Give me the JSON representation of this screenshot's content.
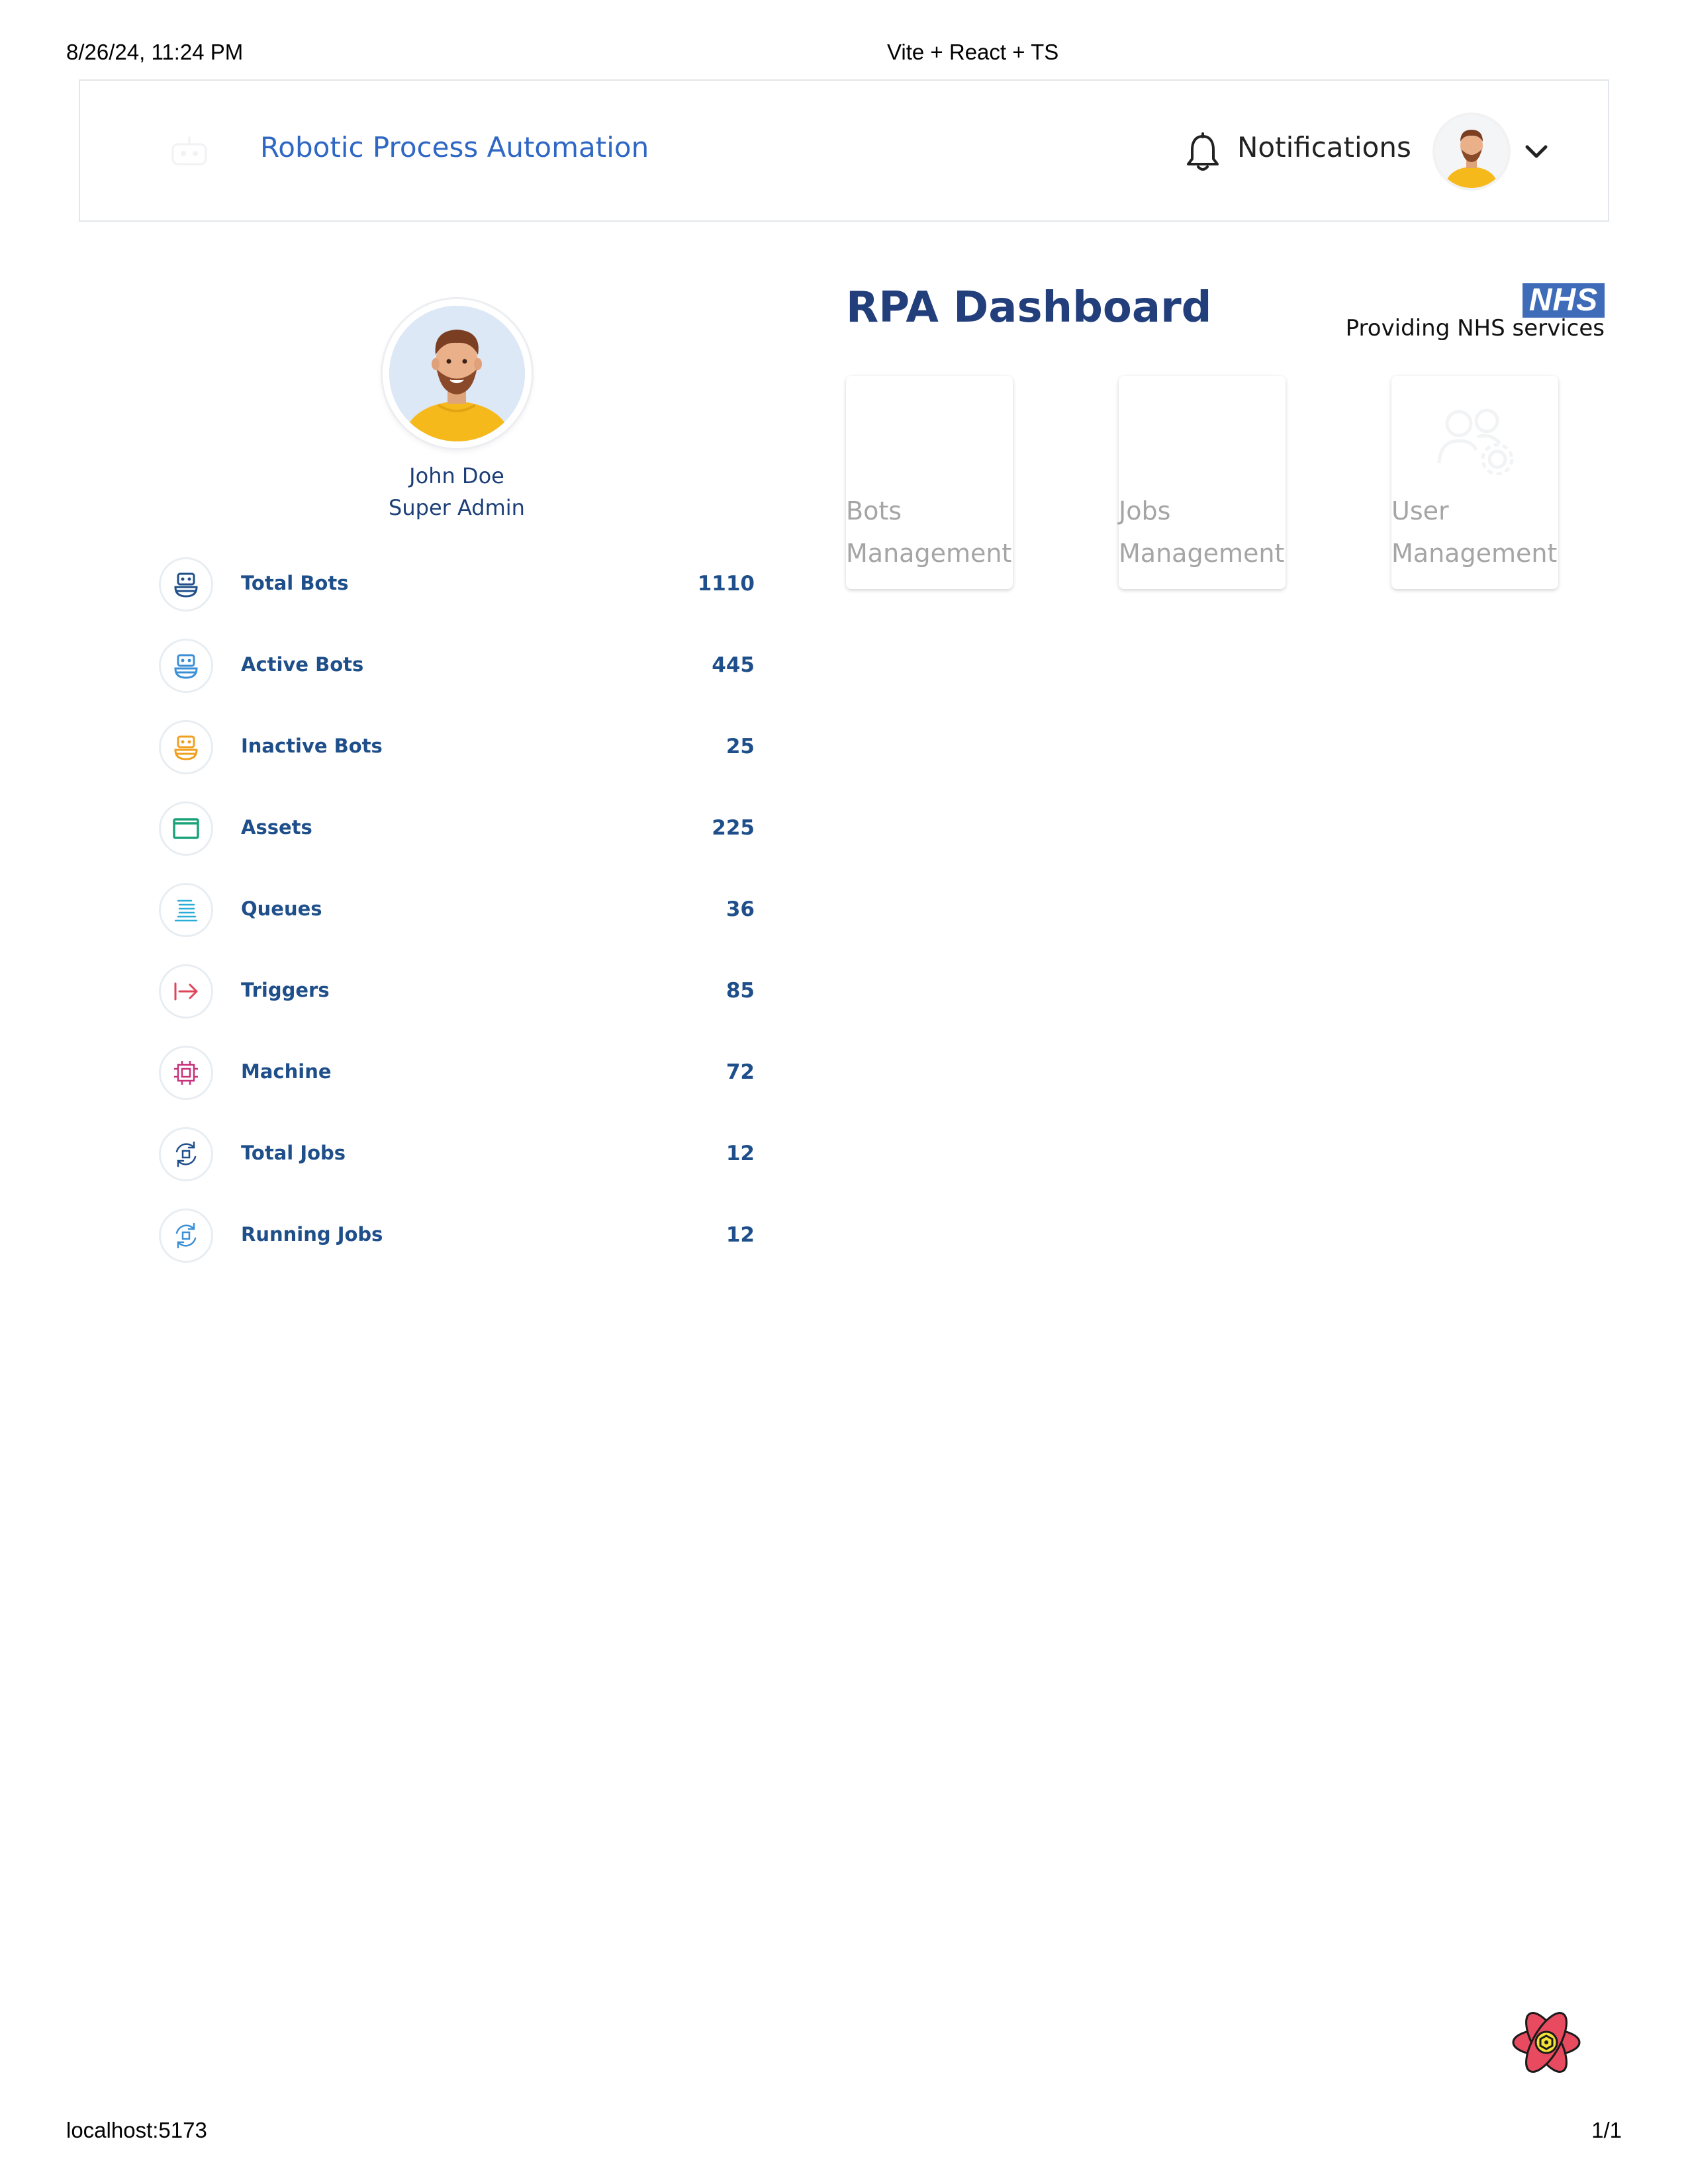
{
  "print_header": {
    "datetime": "8/26/24, 11:24 PM",
    "page_title": "Vite + React + TS"
  },
  "print_footer": {
    "url": "localhost:5173",
    "page_count": "1/1"
  },
  "topbar": {
    "app_title": "Robotic Process Automation",
    "notifications_label": "Notifications"
  },
  "profile": {
    "name": "John Doe",
    "role": "Super Admin"
  },
  "stats": [
    {
      "label": "Total Bots",
      "value": "1110",
      "icon": "robot-icon",
      "color": "#1f4f8a"
    },
    {
      "label": "Active Bots",
      "value": "445",
      "icon": "robot-icon",
      "color": "#3b8fd6"
    },
    {
      "label": "Inactive Bots",
      "value": "25",
      "icon": "robot-icon",
      "color": "#f0a020"
    },
    {
      "label": "Assets",
      "value": "225",
      "icon": "window-icon",
      "color": "#1aa37a"
    },
    {
      "label": "Queues",
      "value": "36",
      "icon": "queue-list-icon",
      "color": "#2aaed8"
    },
    {
      "label": "Triggers",
      "value": "85",
      "icon": "trigger-arrow-icon",
      "color": "#e0445a"
    },
    {
      "label": "Machine",
      "value": "72",
      "icon": "machine-icon",
      "color": "#c8307a"
    },
    {
      "label": "Total Jobs",
      "value": "12",
      "icon": "jobs-cycle-icon",
      "color": "#1f4f8a"
    },
    {
      "label": "Running Jobs",
      "value": "12",
      "icon": "jobs-cycle-icon",
      "color": "#3b8fd6"
    }
  ],
  "dashboard": {
    "title": "RPA Dashboard",
    "nhs_logo_text": "NHS",
    "nhs_tagline": "Providing NHS services",
    "cards": [
      {
        "line1": "Bots",
        "line2": "Management"
      },
      {
        "line1": "Jobs",
        "line2": "Management"
      },
      {
        "line1": "User",
        "line2": "Management"
      }
    ]
  }
}
